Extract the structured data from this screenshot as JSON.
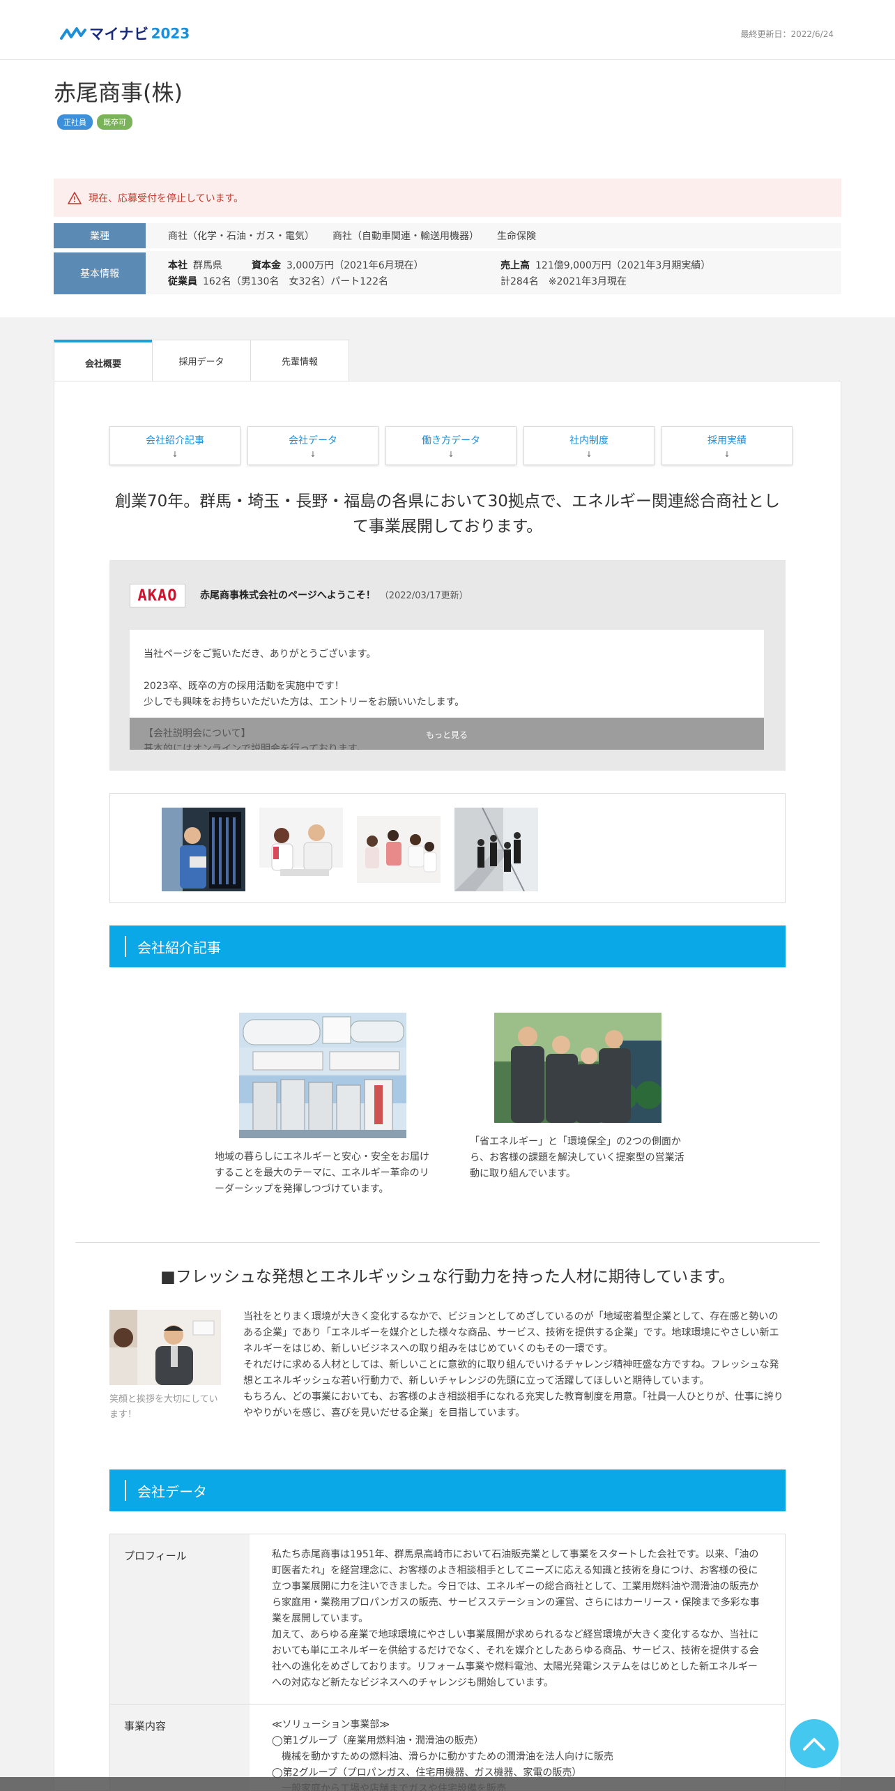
{
  "header": {
    "logo_text": "マイナビ",
    "logo_year": "2023",
    "updated": "最終更新日：2022/6/24"
  },
  "company": {
    "name": "赤尾商事(株)",
    "tags": [
      "正社員",
      "既卒可"
    ],
    "notice": "現在、応募受付を停止しています。"
  },
  "info": {
    "industry_label": "業種",
    "industries": [
      "商社（化学・石油・ガス・電気）",
      "商社（自動車関連・輸送用機器）",
      "生命保険"
    ],
    "basic_label": "基本情報",
    "hq_label": "本社",
    "hq_value": "群馬県",
    "capital_label": "資本金",
    "capital_value": "3,000万円（2021年6月現在）",
    "sales_label": "売上高",
    "sales_value": "121億9,000万円（2021年3月期実績）",
    "employees_label": "従業員",
    "employees_value": "162名（男130名　女32名）パート122名",
    "employees_total": "計284名　※2021年3月現在"
  },
  "tabs": [
    {
      "label": "会社概要"
    },
    {
      "label": "採用データ"
    },
    {
      "label": "先輩情報"
    }
  ],
  "anchors": [
    {
      "label": "会社紹介記事",
      "arrow": "↓"
    },
    {
      "label": "会社データ",
      "arrow": "↓"
    },
    {
      "label": "働き方データ",
      "arrow": "↓"
    },
    {
      "label": "社内制度",
      "arrow": "↓"
    },
    {
      "label": "採用実績",
      "arrow": "↓"
    }
  ],
  "catch": "創業70年。群馬・埼玉・長野・福島の各県において30拠点で、エネルギー関連総合商社として事業展開しております。",
  "welcome": {
    "logo": "AKAO",
    "title": "赤尾商事株式会社のページへようこそ！",
    "date": "（2022/03/17更新）",
    "body": "当社ページをご覧いただき、ありがとうございます。\n\n2023卒、既卒の方の採用活動を実施中です！\n少しでも興味をお持ちいただいた方は、エントリーをお願いいたします。",
    "preview": "【会社説明会について】\n基本的にはオンラインで説明会を行っております。",
    "more": "もっと見る"
  },
  "section_intro": "会社紹介記事",
  "articles": [
    {
      "text": "地域の暮らしにエネルギーと安心・安全をお届けすることを最大のテーマに、エネルギー革命のリーダーシップを発揮しつづけています。"
    },
    {
      "text": "「省エネルギー」と「環境保全」の2つの側面から、お客様の課題を解決していく提案型の営業活動に取り組んでいます。"
    }
  ],
  "message": {
    "heading": "■フレッシュな発想とエネルギッシュな行動力を持った人材に期待しています。",
    "caption": "笑顔と挨拶を大切にしています！",
    "p1": "当社をとりまく環境が大きく変化するなかで、ビジョンとしてめざしているのが「地域密着型企業として、存在感と勢いのある企業」であり「エネルギーを媒介とした様々な商品、サービス、技術を提供する企業」です。地球環境にやさしい新エネルギーをはじめ、新しいビジネスへの取り組みをはじめていくのもその一環です。",
    "p2": "それだけに求める人材としては、新しいことに意欲的に取り組んでいけるチャレンジ精神旺盛な方ですね。フレッシュな発想とエネルギッシュな若い行動力で、新しいチャレンジの先頭に立って活躍してほしいと期待しています。",
    "p3": "もちろん、どの事業においても、お客様のよき相談相手になれる充実した教育制度を用意。「社員一人ひとりが、仕事に誇りややりがいを感じ、喜びを見いだせる企業」を目指しています。"
  },
  "section_data": "会社データ",
  "company_data": [
    {
      "label": "プロフィール",
      "value": "私たち赤尾商事は1951年、群馬県高崎市において石油販売業として事業をスタートした会社です。以来、「油の町医者たれ」を経営理念に、お客様のよき相談相手としてニーズに応える知識と技術を身につけ、お客様の役に立つ事業展開に力を注いできました。今日では、エネルギーの総合商社として、工業用燃料油や潤滑油の販売から家庭用・業務用プロパンガスの販売、サービスステーションの運営、さらにはカーリース・保険まで多彩な事業を展開しています。\n加えて、あらゆる産業で地球環境にやさしい事業展開が求められるなど経営環境が大きく変化するなか、当社においても単にエネルギーを供給するだけでなく、それを媒介としたあらゆる商品、サービス、技術を提供する会社への進化をめざしております。リフォーム事業や燃料電池、太陽光発電システムをはじめとした新エネルギーへの対応など新たなビジネスへのチャレンジも開始しています。"
    },
    {
      "label": "事業内容",
      "value": "≪ソリューション事業部≫\n◯第1グループ（産業用燃料油・潤滑油の販売）\n　機械を動かすための燃料油、滑らかに動かすための潤滑油を法人向けに販売\n◯第2グループ（プロパンガス、住宅用機器、ガス機器、家電の販売）\n　一般家庭から工場や店舗までガスや住宅設備を販売"
    }
  ],
  "colors": {
    "accent": "#0aa8e6",
    "label_bg": "#5b8ab5",
    "notice": "#c0392b"
  }
}
